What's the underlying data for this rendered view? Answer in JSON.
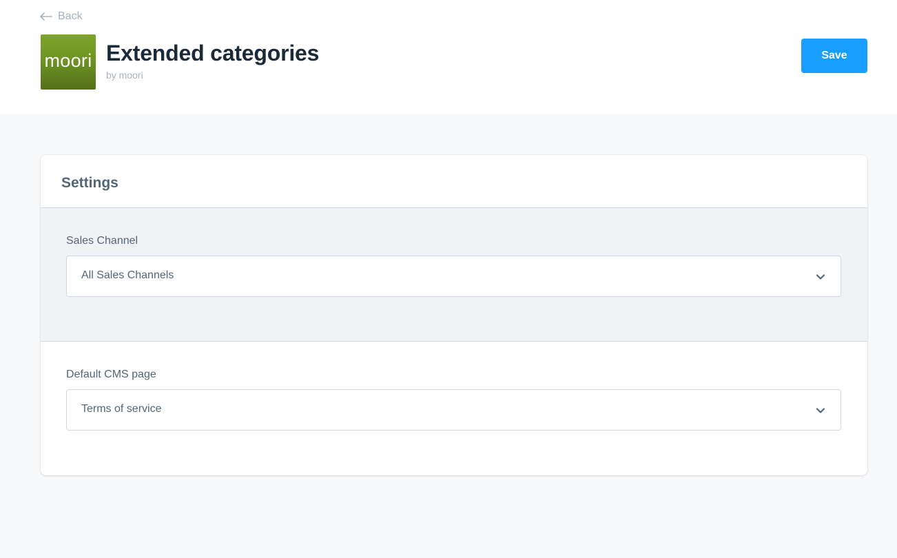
{
  "header": {
    "back_label": "Back",
    "app_title": "Extended categories",
    "app_author": "by moori",
    "logo_text": "moori",
    "save_label": "Save"
  },
  "settings": {
    "title": "Settings",
    "sales_channel": {
      "label": "Sales Channel",
      "value": "All Sales Channels"
    },
    "default_cms_page": {
      "label": "Default CMS page",
      "value": "Terms of service"
    }
  },
  "icons": {
    "back": "arrow-left-icon",
    "select_arrow": "chevron-down-icon"
  },
  "colors": {
    "primary": "#189eff",
    "title": "#1b2a38",
    "text": "#52667a",
    "muted": "#a6b3bf",
    "logo_green": "#6e9422"
  }
}
